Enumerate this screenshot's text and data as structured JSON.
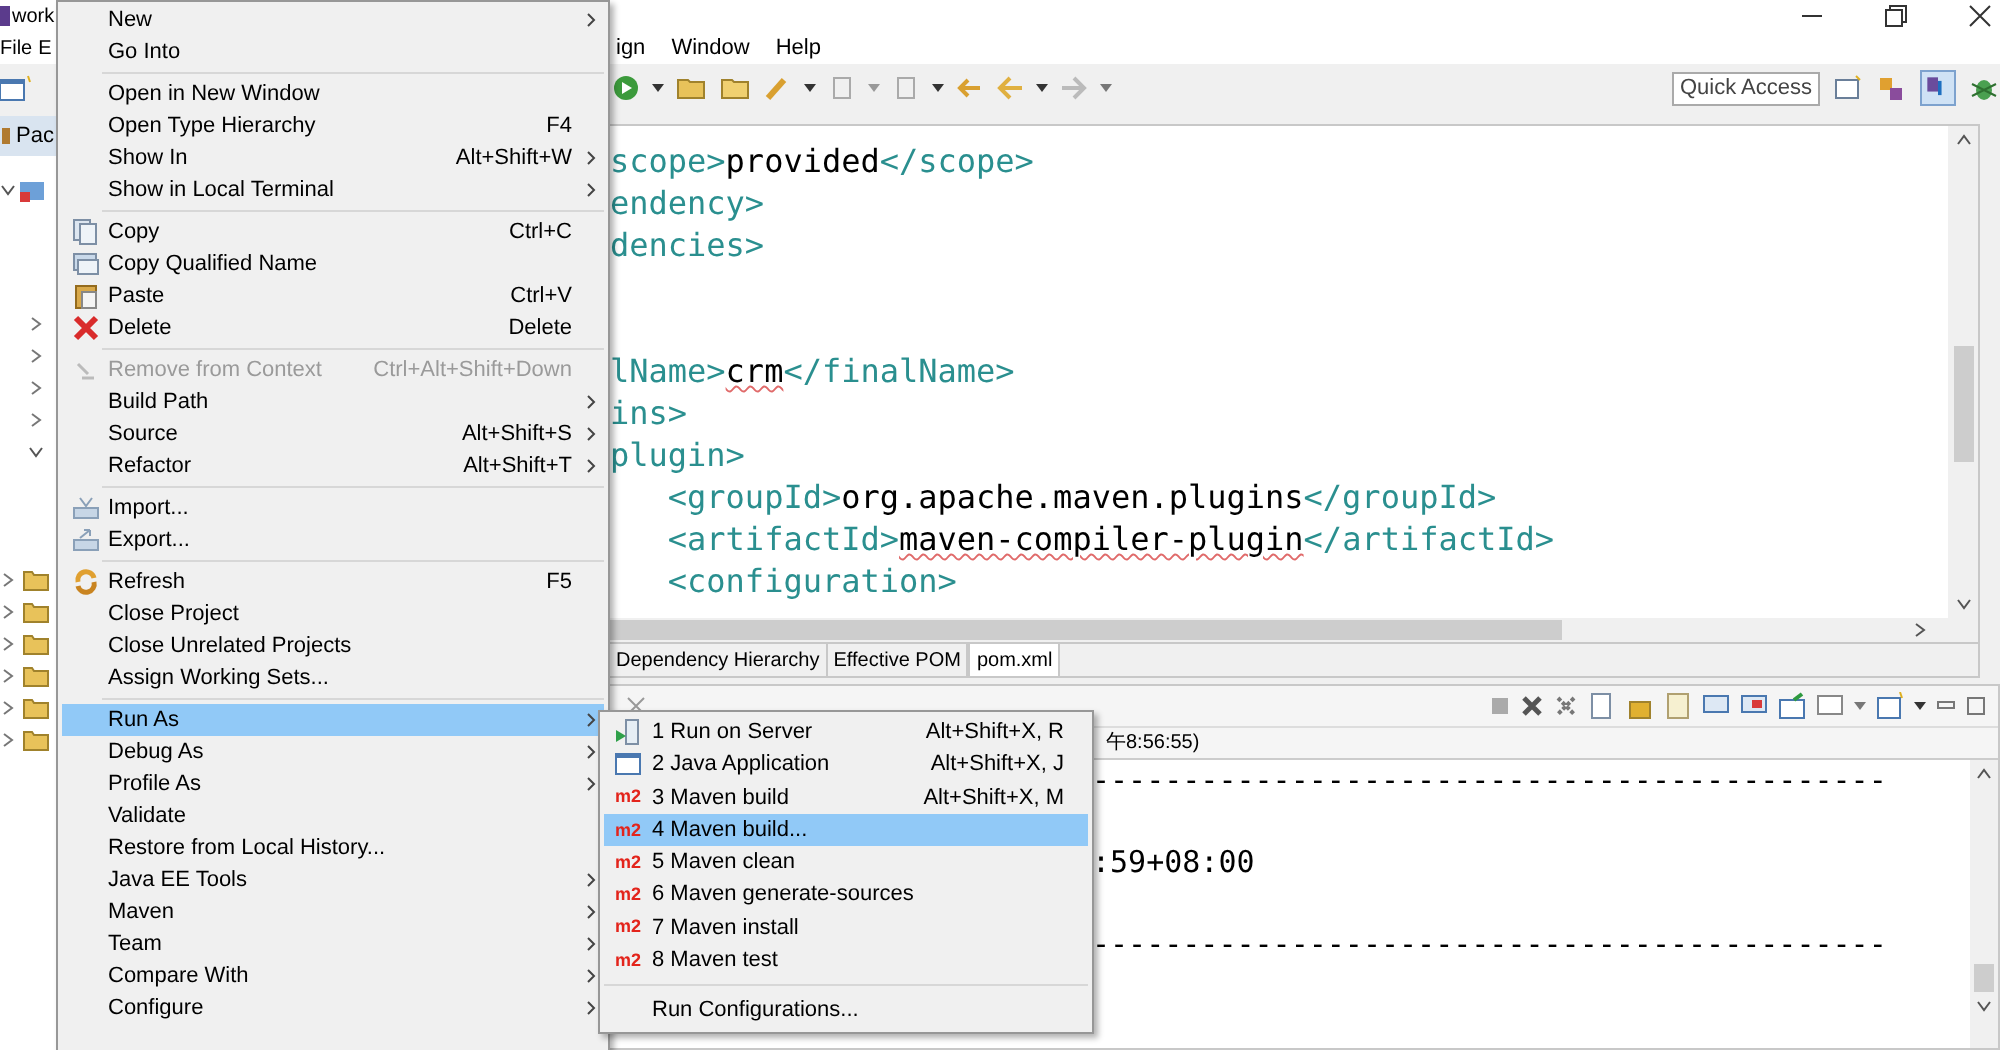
{
  "window": {
    "title": "work"
  },
  "menubar": {
    "left": [
      "File",
      "E"
    ],
    "right": [
      "ign",
      "Window",
      "Help"
    ]
  },
  "left_panel": {
    "tab": "Pac"
  },
  "toolbar": {
    "quick_access": "Quick Access"
  },
  "editor": {
    "lines": [
      {
        "segments": [
          {
            "text": "scope>",
            "kind": "tag"
          },
          {
            "text": "provided",
            "kind": "text",
            "misspelled": false
          },
          {
            "text": "</scope>",
            "kind": "tag"
          }
        ]
      },
      {
        "segments": [
          {
            "text": "endency>",
            "kind": "tag"
          }
        ]
      },
      {
        "segments": [
          {
            "text": "dencies>",
            "kind": "tag"
          }
        ]
      },
      {
        "kind": "blank"
      },
      {
        "kind": "blank"
      },
      {
        "segments": [
          {
            "text": "lName>",
            "kind": "tag"
          },
          {
            "text": "crm",
            "kind": "text",
            "misspelled": true
          },
          {
            "text": "</finalName>",
            "kind": "tag"
          }
        ]
      },
      {
        "segments": [
          {
            "text": "ins>",
            "kind": "tag"
          }
        ]
      },
      {
        "segments": [
          {
            "text": "plugin>",
            "kind": "tag"
          }
        ]
      },
      {
        "segments": [
          {
            "text": "   <groupId>",
            "kind": "tag"
          },
          {
            "text": "org.apache.maven.plugins",
            "kind": "text",
            "misspelled": false
          },
          {
            "text": "</groupId>",
            "kind": "tag"
          }
        ]
      },
      {
        "segments": [
          {
            "text": "   <artifactId>",
            "kind": "tag"
          },
          {
            "text": "maven-compiler-plugin",
            "kind": "text",
            "misspelled": true
          },
          {
            "text": "</artifactId>",
            "kind": "tag"
          }
        ]
      },
      {
        "segments": [
          {
            "text": "   <configuration>",
            "kind": "tag"
          }
        ]
      }
    ],
    "tabs": [
      {
        "label": "Dependency Hierarchy",
        "selected": false
      },
      {
        "label": "Effective POM",
        "selected": false
      },
      {
        "label": "pom.xml",
        "selected": true
      }
    ]
  },
  "console": {
    "header": "午8:56:55)",
    "lines": [
      {
        "text": "--------------------------------------------"
      },
      {
        "kind": "blank"
      },
      {
        "text": ":59+08:00"
      },
      {
        "kind": "blank"
      },
      {
        "text": "--------------------------------------------"
      }
    ]
  },
  "context_menu": {
    "groups": [
      [
        {
          "label": "New",
          "submenu": true,
          "selected": false,
          "disabled": false
        },
        {
          "label": "Go Into",
          "submenu": false,
          "selected": false,
          "disabled": false
        }
      ],
      [
        {
          "label": "Open in New Window",
          "submenu": false,
          "selected": false,
          "disabled": false
        },
        {
          "label": "Open Type Hierarchy",
          "shortcut": "F4",
          "submenu": false,
          "selected": false,
          "disabled": false
        },
        {
          "label": "Show In",
          "shortcut": "Alt+Shift+W",
          "submenu": true,
          "selected": false,
          "disabled": false
        },
        {
          "label": "Show in Local Terminal",
          "submenu": true,
          "selected": false,
          "disabled": false
        }
      ],
      [
        {
          "label": "Copy",
          "shortcut": "Ctrl+C",
          "submenu": false,
          "selected": false,
          "disabled": false
        },
        {
          "label": "Copy Qualified Name",
          "submenu": false,
          "selected": false,
          "disabled": false
        },
        {
          "label": "Paste",
          "shortcut": "Ctrl+V",
          "submenu": false,
          "selected": false,
          "disabled": false
        },
        {
          "label": "Delete",
          "shortcut": "Delete",
          "submenu": false,
          "selected": false,
          "disabled": false
        }
      ],
      [
        {
          "label": "Remove from Context",
          "shortcut": "Ctrl+Alt+Shift+Down",
          "submenu": false,
          "selected": false,
          "disabled": true
        },
        {
          "label": "Build Path",
          "submenu": true,
          "selected": false,
          "disabled": false
        },
        {
          "label": "Source",
          "shortcut": "Alt+Shift+S",
          "submenu": true,
          "selected": false,
          "disabled": false
        },
        {
          "label": "Refactor",
          "shortcut": "Alt+Shift+T",
          "submenu": true,
          "selected": false,
          "disabled": false
        }
      ],
      [
        {
          "label": "Import...",
          "submenu": false,
          "selected": false,
          "disabled": false
        },
        {
          "label": "Export...",
          "submenu": false,
          "selected": false,
          "disabled": false
        }
      ],
      [
        {
          "label": "Refresh",
          "shortcut": "F5",
          "submenu": false,
          "selected": false,
          "disabled": false
        },
        {
          "label": "Close Project",
          "submenu": false,
          "selected": false,
          "disabled": false
        },
        {
          "label": "Close Unrelated Projects",
          "submenu": false,
          "selected": false,
          "disabled": false
        },
        {
          "label": "Assign Working Sets...",
          "submenu": false,
          "selected": false,
          "disabled": false
        }
      ],
      [
        {
          "label": "Run As",
          "submenu": true,
          "selected": true,
          "disabled": false
        },
        {
          "label": "Debug As",
          "submenu": true,
          "selected": false,
          "disabled": false
        },
        {
          "label": "Profile As",
          "submenu": true,
          "selected": false,
          "disabled": false
        },
        {
          "label": "Validate",
          "submenu": false,
          "selected": false,
          "disabled": false
        },
        {
          "label": "Restore from Local History...",
          "submenu": false,
          "selected": false,
          "disabled": false
        },
        {
          "label": "Java EE Tools",
          "submenu": true,
          "selected": false,
          "disabled": false
        },
        {
          "label": "Maven",
          "submenu": true,
          "selected": false,
          "disabled": false
        },
        {
          "label": "Team",
          "submenu": true,
          "selected": false,
          "disabled": false
        },
        {
          "label": "Compare With",
          "submenu": true,
          "selected": false,
          "disabled": false
        },
        {
          "label": "Configure",
          "submenu": true,
          "selected": false,
          "disabled": false
        }
      ]
    ]
  },
  "run_as_submenu": {
    "groups": [
      [
        {
          "label": "1 Run on Server",
          "shortcut": "Alt+Shift+X, R",
          "selected": false
        },
        {
          "label": "2 Java Application",
          "shortcut": "Alt+Shift+X, J",
          "selected": false
        },
        {
          "label": "3 Maven build",
          "shortcut": "Alt+Shift+X, M",
          "badge": "m2",
          "selected": false
        },
        {
          "label": "4 Maven build...",
          "badge": "m2",
          "selected": true
        },
        {
          "label": "5 Maven clean",
          "badge": "m2",
          "selected": false
        },
        {
          "label": "6 Maven generate-sources",
          "badge": "m2",
          "selected": false
        },
        {
          "label": "7 Maven install",
          "badge": "m2",
          "selected": false
        },
        {
          "label": "8 Maven test",
          "badge": "m2",
          "selected": false
        }
      ],
      [
        {
          "label": "Run Configurations...",
          "selected": false
        }
      ]
    ]
  }
}
